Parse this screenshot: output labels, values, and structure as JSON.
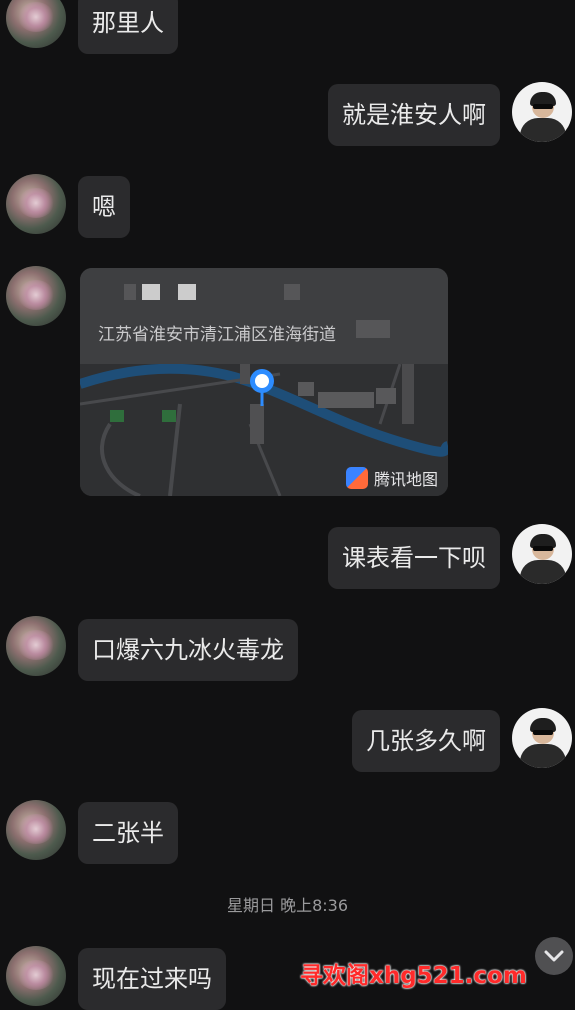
{
  "messages": [
    {
      "side": "left",
      "text": "那里人"
    },
    {
      "side": "right",
      "text": "就是淮安人啊"
    },
    {
      "side": "left",
      "text": "嗯"
    },
    {
      "side": "left",
      "type": "location"
    },
    {
      "side": "right",
      "text": "课表看一下呗"
    },
    {
      "side": "left",
      "text": "口爆六九冰火毒龙"
    },
    {
      "side": "right",
      "text": "几张多久啊"
    },
    {
      "side": "left",
      "text": "二张半"
    },
    {
      "side": "left",
      "text": "现在过来吗"
    }
  ],
  "location_card": {
    "address": "江苏省淮安市清江浦区淮海街道",
    "provider": "腾讯地图",
    "provider_icon": "tencent-map-logo-icon",
    "pin_icon": "location-pin-icon"
  },
  "timestamp": "星期日 晚上8:36",
  "scroll_button": {
    "icon": "chevron-down-icon"
  },
  "watermark": "寻欢阁xhg521.com",
  "colors": {
    "background": "#111112",
    "bubble": "#2b2b2d",
    "text": "#eaeaea",
    "timestamp": "#9a9a9c",
    "map_road": "#1e4e78",
    "pin": "#2d8cff",
    "watermark": "#ff2a2a"
  }
}
